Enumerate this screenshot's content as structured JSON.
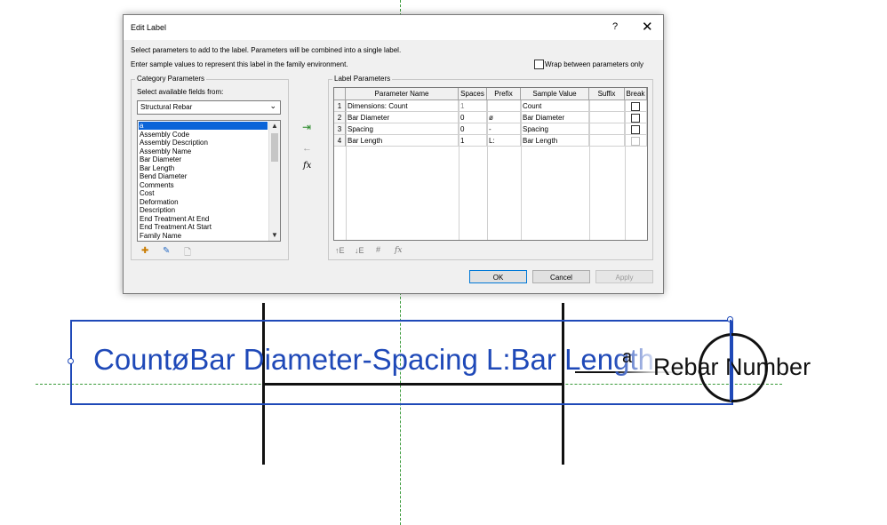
{
  "canvas": {
    "label_text": "CountøBar Diameter-Spacing  L:Bar Length",
    "sample_a": "a",
    "tag_text": "Rebar Number"
  },
  "dialog": {
    "title": "Edit Label",
    "help": "?",
    "close": "✕",
    "instructions_1": "Select parameters to add to the label.  Parameters will be combined into a single label.",
    "instructions_2": "Enter sample values to represent this label in the family environment.",
    "wrap_label": "Wrap between parameters only",
    "wrap_checked": false,
    "category": {
      "group_title": "Category Parameters",
      "select_label": "Select available fields from:",
      "selected_category": "Structural Rebar",
      "fields": [
        "a",
        "Assembly Code",
        "Assembly Description",
        "Assembly Name",
        "Bar Diameter",
        "Bar Length",
        "Bend Diameter",
        "Comments",
        "Cost",
        "Deformation",
        "Description",
        "End Treatment At End",
        "End Treatment At Start",
        "Family Name"
      ],
      "selected_field": "a"
    },
    "middle_icons": {
      "add": "add-parameter-icon",
      "remove": "remove-parameter-icon",
      "formula": "fx"
    },
    "label_params": {
      "group_title": "Label Parameters",
      "columns": [
        "Parameter Name",
        "Spaces",
        "Prefix",
        "Sample Value",
        "Suffix",
        "Break"
      ],
      "rows": [
        {
          "num": "1",
          "name": "Dimensions: Count",
          "spaces": "1",
          "prefix": "",
          "sample": "Count",
          "suffix": "",
          "break": false
        },
        {
          "num": "2",
          "name": "Bar Diameter",
          "spaces": "0",
          "prefix": "ø",
          "sample": "Bar Diameter",
          "suffix": "",
          "break": false
        },
        {
          "num": "3",
          "name": "Spacing",
          "spaces": "0",
          "prefix": "-",
          "sample": "Spacing",
          "suffix": "",
          "break": false
        },
        {
          "num": "4",
          "name": "Bar Length",
          "spaces": "1",
          "prefix": "L:",
          "sample": "Bar Length",
          "suffix": "",
          "break": false
        }
      ]
    },
    "buttons": {
      "ok": "OK",
      "cancel": "Cancel",
      "apply": "Apply"
    }
  }
}
